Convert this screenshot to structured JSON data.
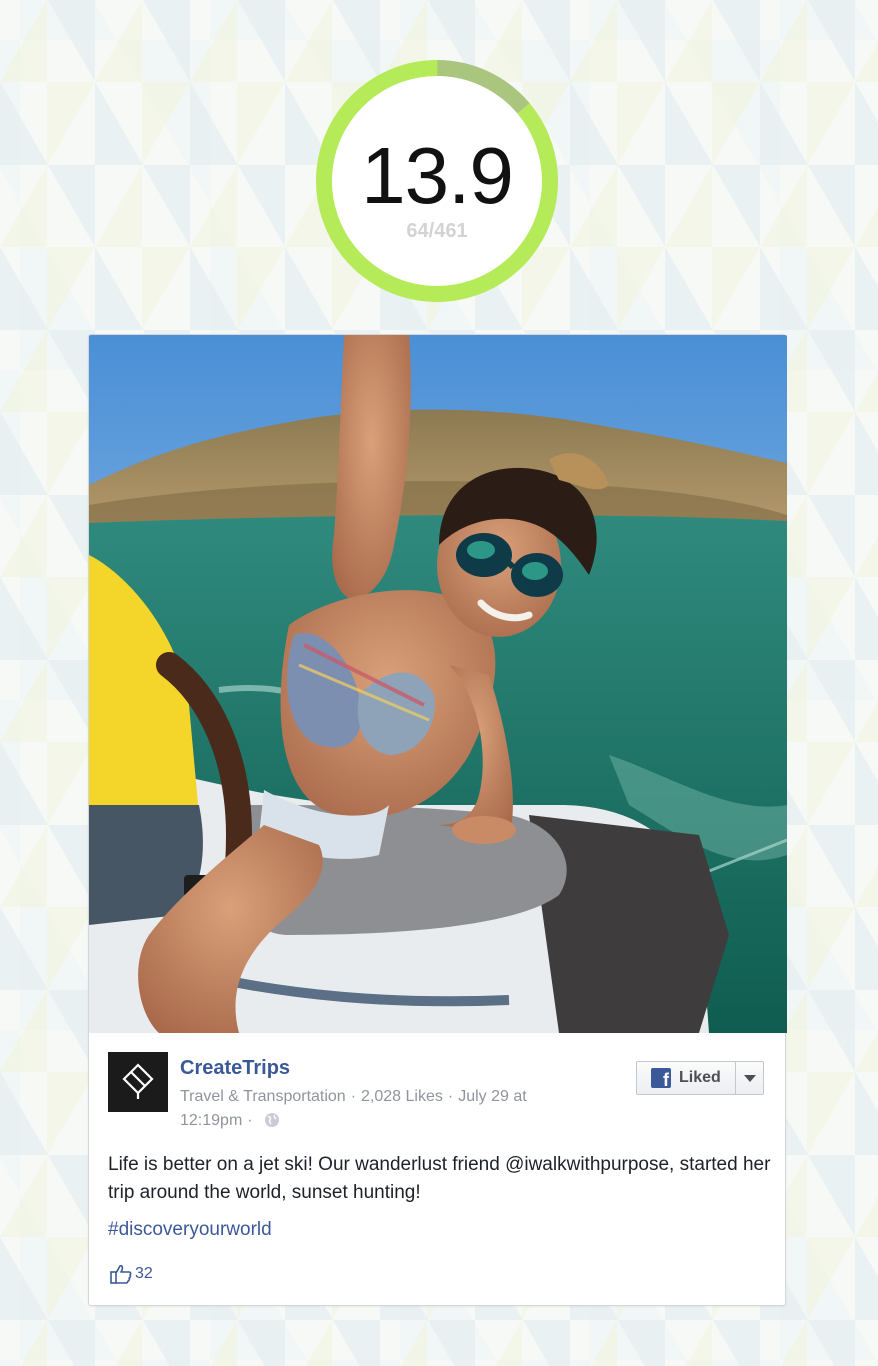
{
  "score": {
    "value": "13.9",
    "fraction": "64/461",
    "ring_color": "#b5ea58",
    "ring_remaining_color": "#a9c57e"
  },
  "post": {
    "photo": {
      "icon": "photo-jet-ski-selfie"
    },
    "page_avatar_icon": "createtrips-logo-icon",
    "page_name": "CreateTrips",
    "category": "Travel & Transportation",
    "page_likes": "2,028 Likes",
    "date": "July 29 at",
    "time": "12:19pm",
    "privacy_icon": "globe-icon",
    "like_button": {
      "label": "Liked",
      "icon": "facebook-icon",
      "menu_icon": "chevron-down-icon"
    },
    "text": "Life is better on a jet ski! Our wanderlust friend @iwalkwithpurpose, started her trip around the world, sunset hunting!",
    "hashtag": "#discoveryourworld",
    "like_count": "32",
    "like_icon": "thumbs-up-icon"
  },
  "colors": {
    "link": "#3b5998",
    "meta": "#90949c",
    "text": "#1d2129"
  }
}
